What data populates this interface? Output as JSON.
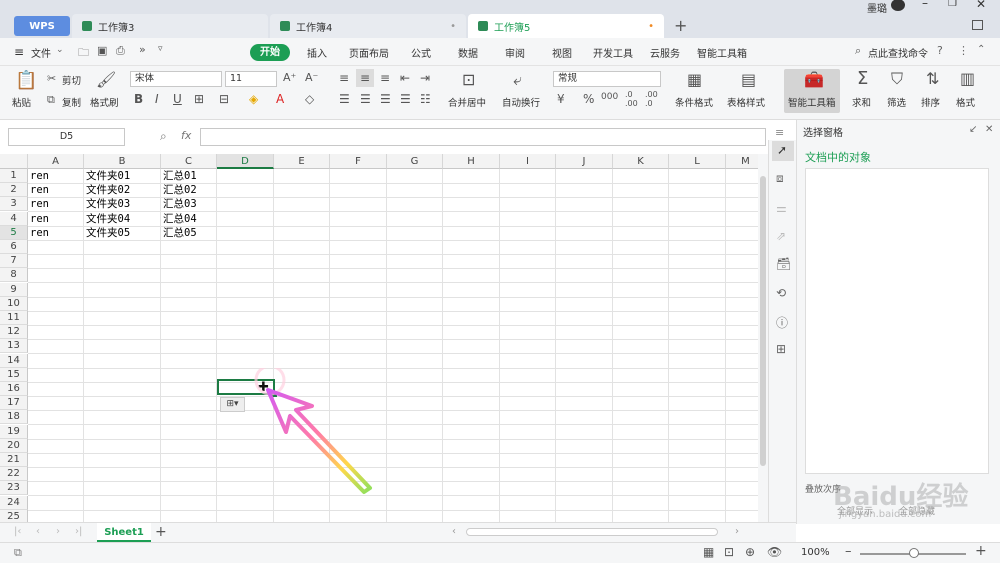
{
  "titlebar": {
    "brand": "WPS",
    "tabs": [
      {
        "label": "工作簿3"
      },
      {
        "label": "工作簿4"
      },
      {
        "label": "工作簿5"
      }
    ],
    "user_name": "墨璐"
  },
  "menubar": {
    "file": "文件",
    "items": [
      "开始",
      "插入",
      "页面布局",
      "公式",
      "数据",
      "审阅",
      "视图",
      "开发工具",
      "云服务",
      "智能工具箱"
    ],
    "search": "点此查找命令"
  },
  "ribbon": {
    "paste": "粘贴",
    "cut": "剪切",
    "copy": "复制",
    "format_painter": "格式刷",
    "font_name": "宋体",
    "font_size": "11",
    "merge_center": "合并居中",
    "wrap_text": "自动换行",
    "number_format": "常规",
    "cond_format": "条件格式",
    "table_style": "表格样式",
    "smart_toolbox": "智能工具箱",
    "sum": "求和",
    "filter": "筛选",
    "sort": "排序",
    "format": "格式"
  },
  "formulabar": {
    "name_box": "D5",
    "fx": "fx",
    "value": ""
  },
  "columns": [
    "A",
    "B",
    "C",
    "D",
    "E",
    "F",
    "G",
    "H",
    "I",
    "J",
    "K",
    "L",
    "M"
  ],
  "rows": [
    "1",
    "2",
    "3",
    "4",
    "5",
    "6",
    "7",
    "8",
    "9",
    "10",
    "11",
    "12",
    "13",
    "14",
    "15",
    "16",
    "17",
    "18",
    "19",
    "20",
    "21",
    "22",
    "23",
    "24",
    "25"
  ],
  "cells": [
    [
      "ren",
      "文件夹01",
      "汇总01"
    ],
    [
      "ren",
      "文件夹02",
      "汇总02"
    ],
    [
      "ren",
      "文件夹03",
      "汇总03"
    ],
    [
      "ren",
      "文件夹04",
      "汇总04"
    ],
    [
      "ren",
      "文件夹05",
      "汇总05"
    ]
  ],
  "selected_cell": "D5",
  "rightpanel": {
    "title": "选择窗格",
    "subtitle": "文档中的对象",
    "stack_order": "叠放次序",
    "show_all": "全部显示",
    "hide_all": "全部隐藏"
  },
  "sheetbar": {
    "active_sheet": "Sheet1"
  },
  "statusbar": {
    "zoom": "100%"
  },
  "watermark": {
    "brand": "Baidu经验",
    "url": "jingyan.baidu.com"
  },
  "colors": {
    "accent": "#1c9e54",
    "brand_blue": "#5d8de0"
  }
}
